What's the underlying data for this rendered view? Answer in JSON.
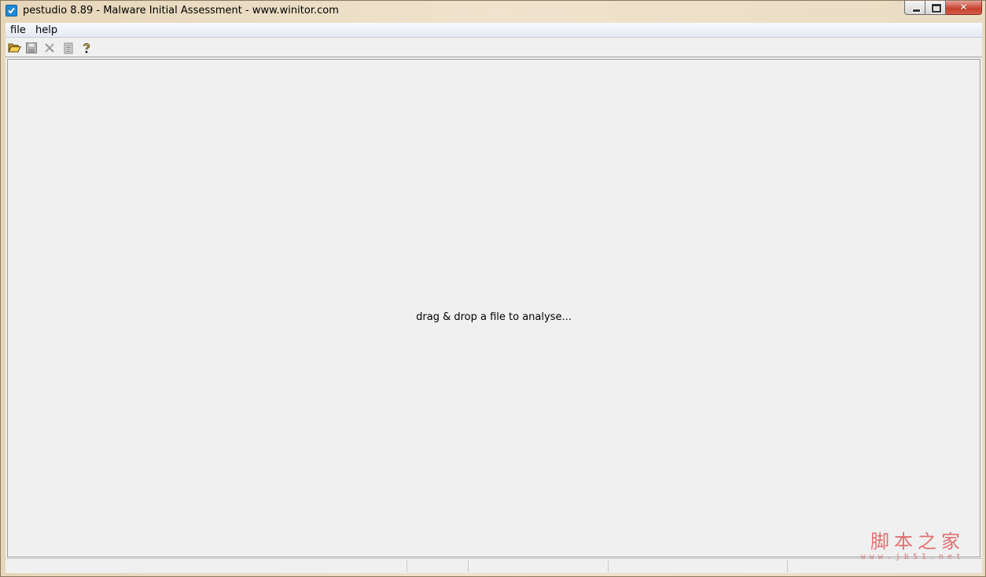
{
  "window": {
    "title": "pestudio 8.89 - Malware Initial Assessment - www.winitor.com",
    "app_icon": "checkbox-check-icon",
    "controls": {
      "minimize_icon": "minimize-icon",
      "maximize_icon": "maximize-icon",
      "close_icon": "close-icon",
      "close_glyph": "✕"
    }
  },
  "menu": {
    "items": [
      {
        "label": "file"
      },
      {
        "label": "help"
      }
    ]
  },
  "toolbar": {
    "buttons": [
      {
        "icon": "open-folder-icon",
        "enabled": true
      },
      {
        "icon": "save-icon",
        "enabled": false
      },
      {
        "icon": "close-file-icon",
        "enabled": false
      },
      {
        "icon": "clipboard-icon",
        "enabled": false
      },
      {
        "icon": "help-icon",
        "enabled": true
      }
    ]
  },
  "main": {
    "drop_hint": "drag & drop a file to analyse..."
  },
  "watermark": {
    "main": "脚本之家",
    "sub": "www.jb51.net"
  },
  "colors": {
    "client_bg": "#f0f0f0",
    "accent_blue": "#1e88d6",
    "close_red": "#c7402c",
    "watermark": "#e05a5a"
  }
}
